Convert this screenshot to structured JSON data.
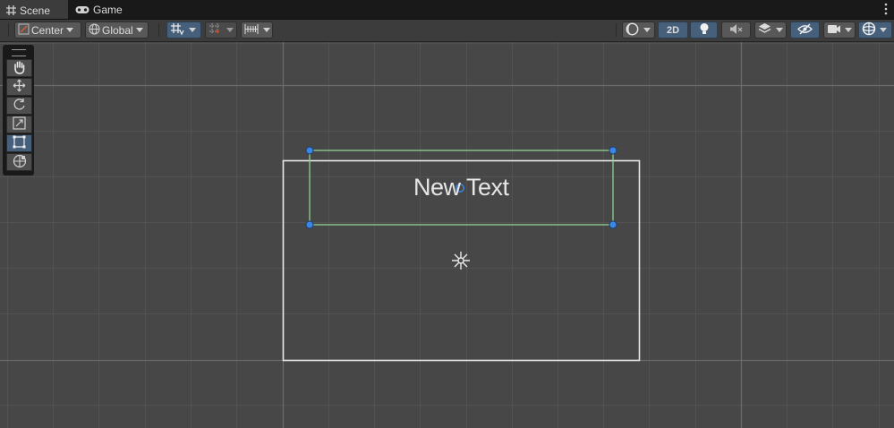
{
  "tabs": [
    {
      "label": "Scene",
      "icon": "grid-icon",
      "active": true
    },
    {
      "label": "Game",
      "icon": "gamepad-icon",
      "active": false
    }
  ],
  "toolbar": {
    "pivot_mode": "Center",
    "pivot_rotation": "Global",
    "mode_2d_label": "2D"
  },
  "scene": {
    "text_object": "New Text"
  },
  "colors": {
    "selection_rect": "#8fd08f",
    "handle": "#3b87e6",
    "canvas_outline": "#e8e8e8",
    "active_button": "#46607c"
  }
}
